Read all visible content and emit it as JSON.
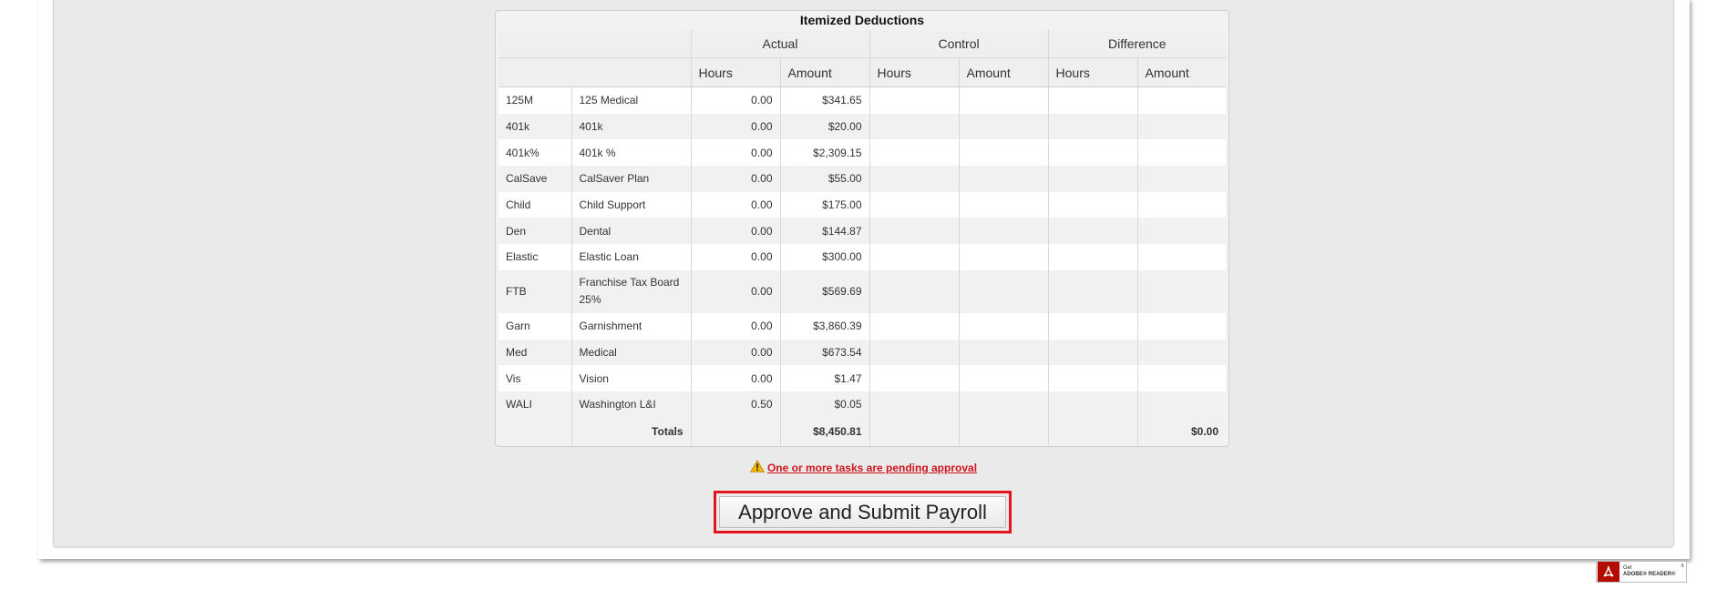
{
  "deductions": {
    "title": "Itemized Deductions",
    "group_headers": [
      "Actual",
      "Control",
      "Difference"
    ],
    "sub_headers": [
      "Hours",
      "Amount",
      "Hours",
      "Amount",
      "Hours",
      "Amount"
    ],
    "rows": [
      {
        "code": "125M",
        "description": "125 Medical",
        "hours": "0.00",
        "amount": "$341.65"
      },
      {
        "code": "401k",
        "description": "401k",
        "hours": "0.00",
        "amount": "$20.00"
      },
      {
        "code": "401k%",
        "description": "401k %",
        "hours": "0.00",
        "amount": "$2,309.15"
      },
      {
        "code": "CalSave",
        "description": "CalSaver Plan",
        "hours": "0.00",
        "amount": "$55.00"
      },
      {
        "code": "Child",
        "description": "Child Support",
        "hours": "0.00",
        "amount": "$175.00"
      },
      {
        "code": "Den",
        "description": "Dental",
        "hours": "0.00",
        "amount": "$144.87"
      },
      {
        "code": "Elastic",
        "description": "Elastic Loan",
        "hours": "0.00",
        "amount": "$300.00"
      },
      {
        "code": "FTB",
        "description": "Franchise Tax Board 25%",
        "hours": "0.00",
        "amount": "$569.69"
      },
      {
        "code": "Garn",
        "description": "Garnishment",
        "hours": "0.00",
        "amount": "$3,860.39"
      },
      {
        "code": "Med",
        "description": "Medical",
        "hours": "0.00",
        "amount": "$673.54"
      },
      {
        "code": "Vis",
        "description": "Vision",
        "hours": "0.00",
        "amount": "$1.47"
      },
      {
        "code": "WALI",
        "description": "Washington L&I",
        "hours": "0.50",
        "amount": "$0.05"
      }
    ],
    "totals": {
      "label": "Totals",
      "actual_amount": "$8,450.81",
      "difference_amount": "$0.00"
    }
  },
  "warning": {
    "icon": "warning-triangle-icon",
    "color": "#f5b800",
    "link_text": "One or more tasks are pending approval",
    "link_color": "#d0141b"
  },
  "submit": {
    "label": "Approve and Submit Payroll",
    "highlight_color": "#e3141e"
  },
  "adobe": {
    "line1": "Get",
    "line2": "ADOBE® READER®",
    "close": "x"
  }
}
